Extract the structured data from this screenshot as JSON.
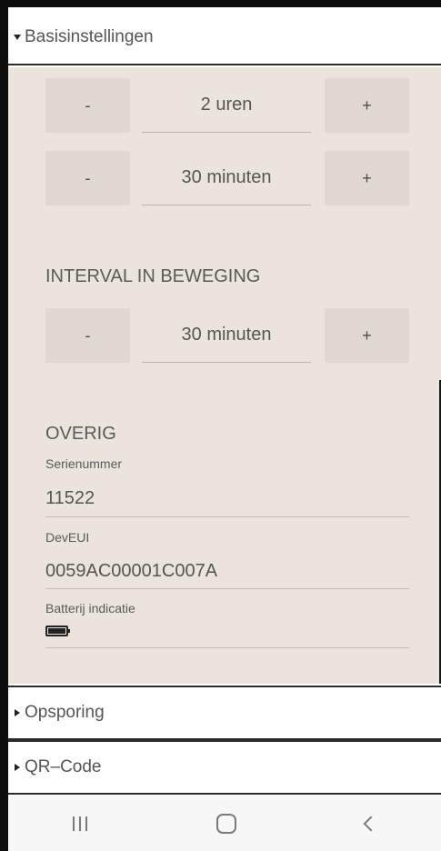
{
  "header": {
    "title": "Basisinstellingen"
  },
  "steppers": [
    {
      "minus": "-",
      "value": "2 uren",
      "plus": "+"
    },
    {
      "minus": "-",
      "value": "30 minuten",
      "plus": "+"
    },
    {
      "minus": "-",
      "value": "30 minuten",
      "plus": "+"
    }
  ],
  "interval": {
    "title": "INTERVAL IN BEWEGING"
  },
  "overig": {
    "title": "OVERIG",
    "serial_label": "Serienummer",
    "serial_value": "11522",
    "deveui_label": "DevEUI",
    "deveui_value": "0059AC00001C007A",
    "battery_label": "Batterij indicatie",
    "battery_icon": "battery-full-icon"
  },
  "sections": [
    {
      "label": "Opsporing"
    },
    {
      "label": "QR–Code"
    }
  ],
  "navbar": {
    "icons": [
      "recent-apps-icon",
      "home-icon",
      "back-icon"
    ]
  }
}
